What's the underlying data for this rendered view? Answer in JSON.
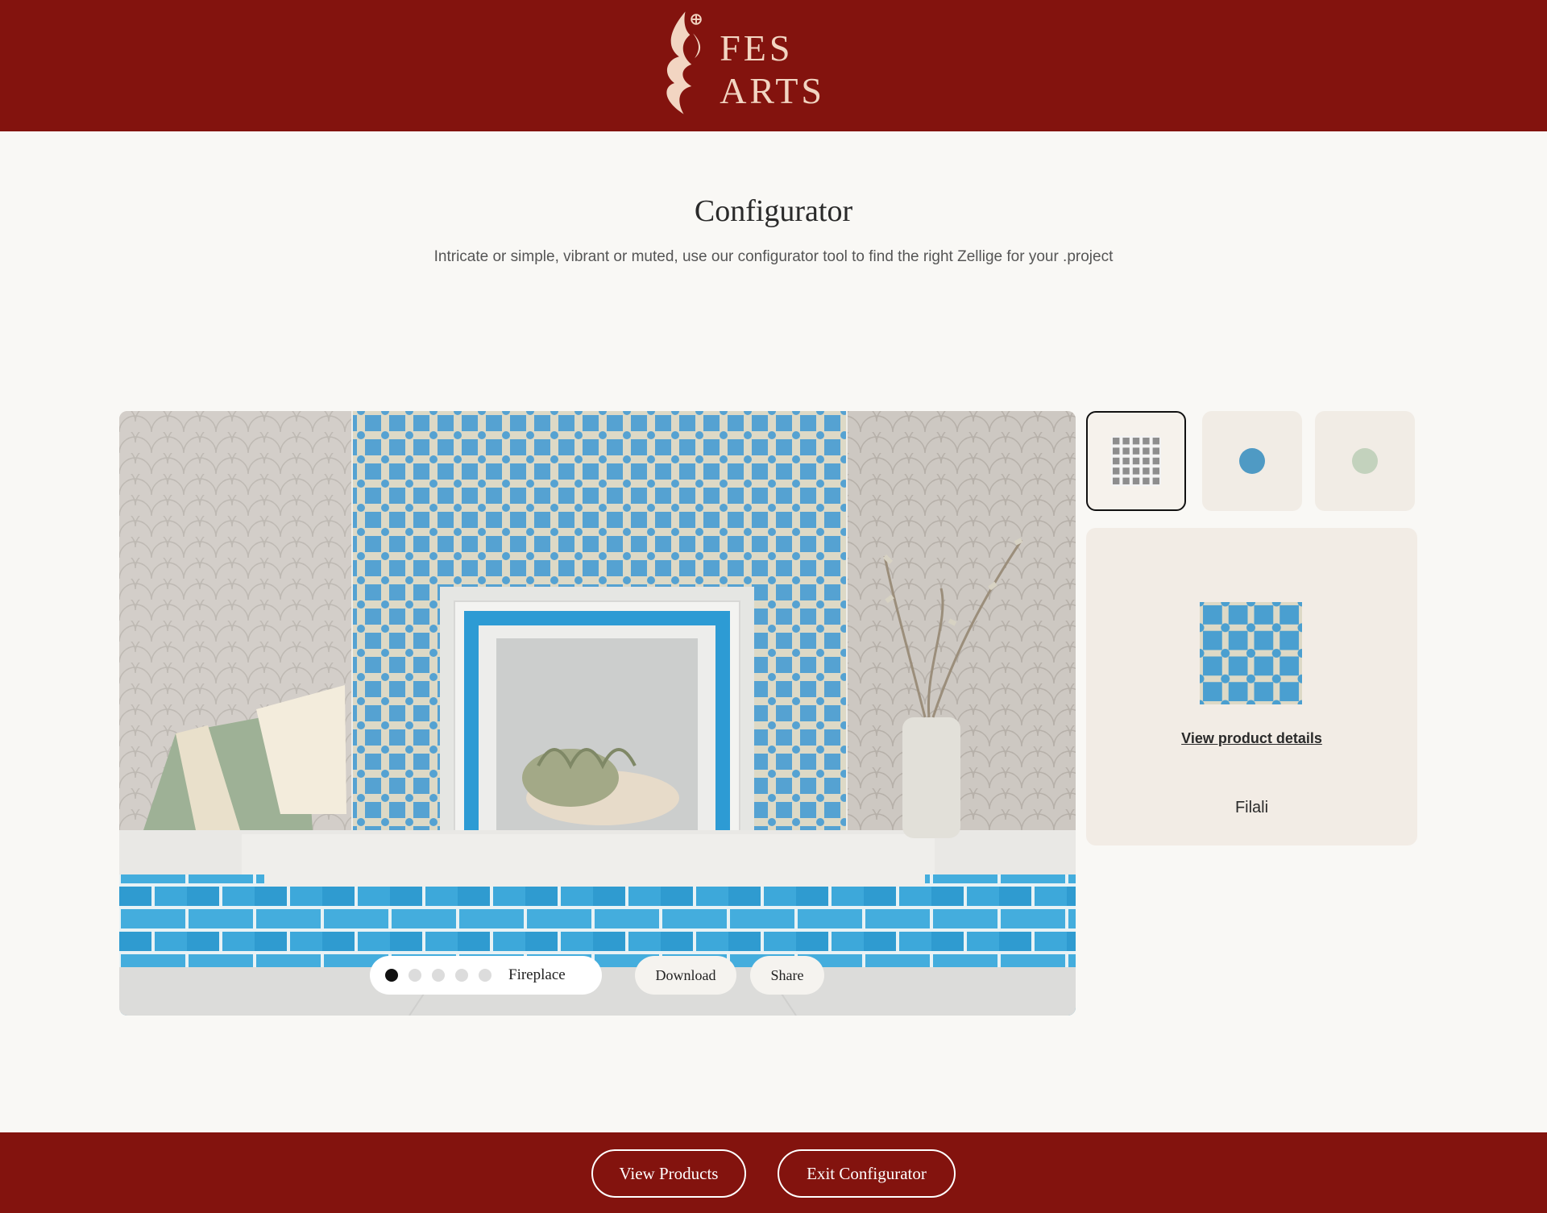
{
  "header": {
    "brand": "FES ARTS",
    "brand_color": "#83130e",
    "logo_color": "#f2d5c2",
    "logo_icon": "flame-calligraphy-icon"
  },
  "main": {
    "title": "Configurator",
    "subtitle": "Intricate or simple, vibrant or muted, use our configurator tool to find the right Zellige for your .project"
  },
  "viewer": {
    "scene_icon": "fireplace-scene-image",
    "dots_total": 5,
    "active_dot": 1,
    "scene_label": "Fireplace",
    "download_label": "Download",
    "share_label": "Share"
  },
  "swatches": [
    {
      "name": "pattern",
      "icon": "checker-pattern-icon",
      "selected": true
    },
    {
      "name": "blue",
      "color": "#4f9ac4",
      "selected": false
    },
    {
      "name": "sage",
      "color": "#c3d2bd",
      "selected": false
    }
  ],
  "product_panel": {
    "link_label": "View product details",
    "product_name": "Filali",
    "tile_colors": {
      "blue": "#4a9fd0",
      "cream": "#ddd9c6"
    }
  },
  "footer": {
    "view_products_label": "View Products",
    "exit_label": "Exit Configurator"
  }
}
